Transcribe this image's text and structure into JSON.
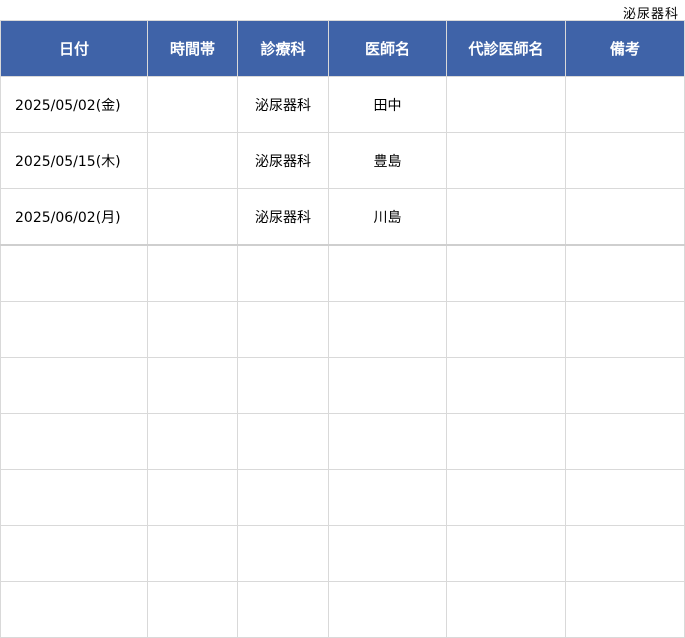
{
  "department_label": "泌尿器科",
  "columns": [
    "日付",
    "時間帯",
    "診療科",
    "医師名",
    "代診医師名",
    "備考"
  ],
  "rows": [
    {
      "date": "2025/05/02(金)",
      "time": "",
      "dept": "泌尿器科",
      "doctor": "田中",
      "substitute": "",
      "note": ""
    },
    {
      "date": "2025/05/15(木)",
      "time": "",
      "dept": "泌尿器科",
      "doctor": "豊島",
      "substitute": "",
      "note": ""
    },
    {
      "date": "2025/06/02(月)",
      "time": "",
      "dept": "泌尿器科",
      "doctor": "川島",
      "substitute": "",
      "note": ""
    },
    {
      "date": "",
      "time": "",
      "dept": "",
      "doctor": "",
      "substitute": "",
      "note": ""
    },
    {
      "date": "",
      "time": "",
      "dept": "",
      "doctor": "",
      "substitute": "",
      "note": ""
    },
    {
      "date": "",
      "time": "",
      "dept": "",
      "doctor": "",
      "substitute": "",
      "note": ""
    },
    {
      "date": "",
      "time": "",
      "dept": "",
      "doctor": "",
      "substitute": "",
      "note": ""
    },
    {
      "date": "",
      "time": "",
      "dept": "",
      "doctor": "",
      "substitute": "",
      "note": ""
    },
    {
      "date": "",
      "time": "",
      "dept": "",
      "doctor": "",
      "substitute": "",
      "note": ""
    },
    {
      "date": "",
      "time": "",
      "dept": "",
      "doctor": "",
      "substitute": "",
      "note": ""
    }
  ]
}
